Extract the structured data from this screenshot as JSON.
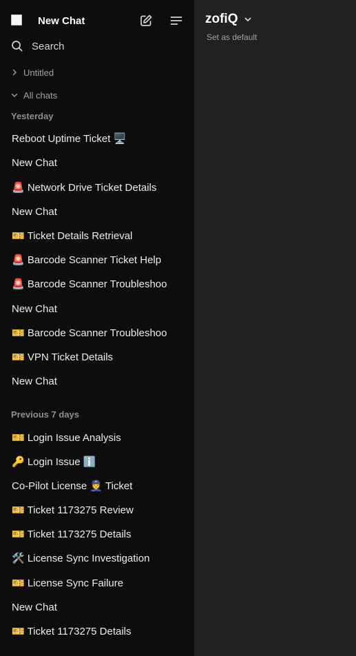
{
  "sidebar": {
    "title": "New Chat",
    "search_label": "Search",
    "folders": [
      {
        "label": "Untitled",
        "expanded": false
      },
      {
        "label": "All chats",
        "expanded": true
      }
    ],
    "groups": [
      {
        "label": "Yesterday",
        "chats": [
          "Reboot Uptime Ticket 🖥️",
          "New Chat",
          "🚨 Network Drive Ticket Details",
          "New Chat",
          "🎫 Ticket Details Retrieval",
          "🚨 Barcode Scanner Ticket Help",
          "🚨 Barcode Scanner Troubleshoo",
          "New Chat",
          "🎫 Barcode Scanner Troubleshoo",
          "🎫 VPN Ticket Details",
          "New Chat"
        ]
      },
      {
        "label": "Previous 7 days",
        "chats": [
          "🎫 Login Issue Analysis",
          "🔑 Login Issue ℹ️",
          "Co-Pilot License 👮 Ticket",
          "🎫 Ticket 1173275 Review",
          "🎫 Ticket 1173275 Details",
          "🛠️ License Sync Investigation",
          "🎫 License Sync Failure",
          "New Chat",
          "🎫 Ticket 1173275 Details"
        ]
      }
    ]
  },
  "main": {
    "model_name": "zofiQ",
    "set_default_label": "Set as default"
  }
}
